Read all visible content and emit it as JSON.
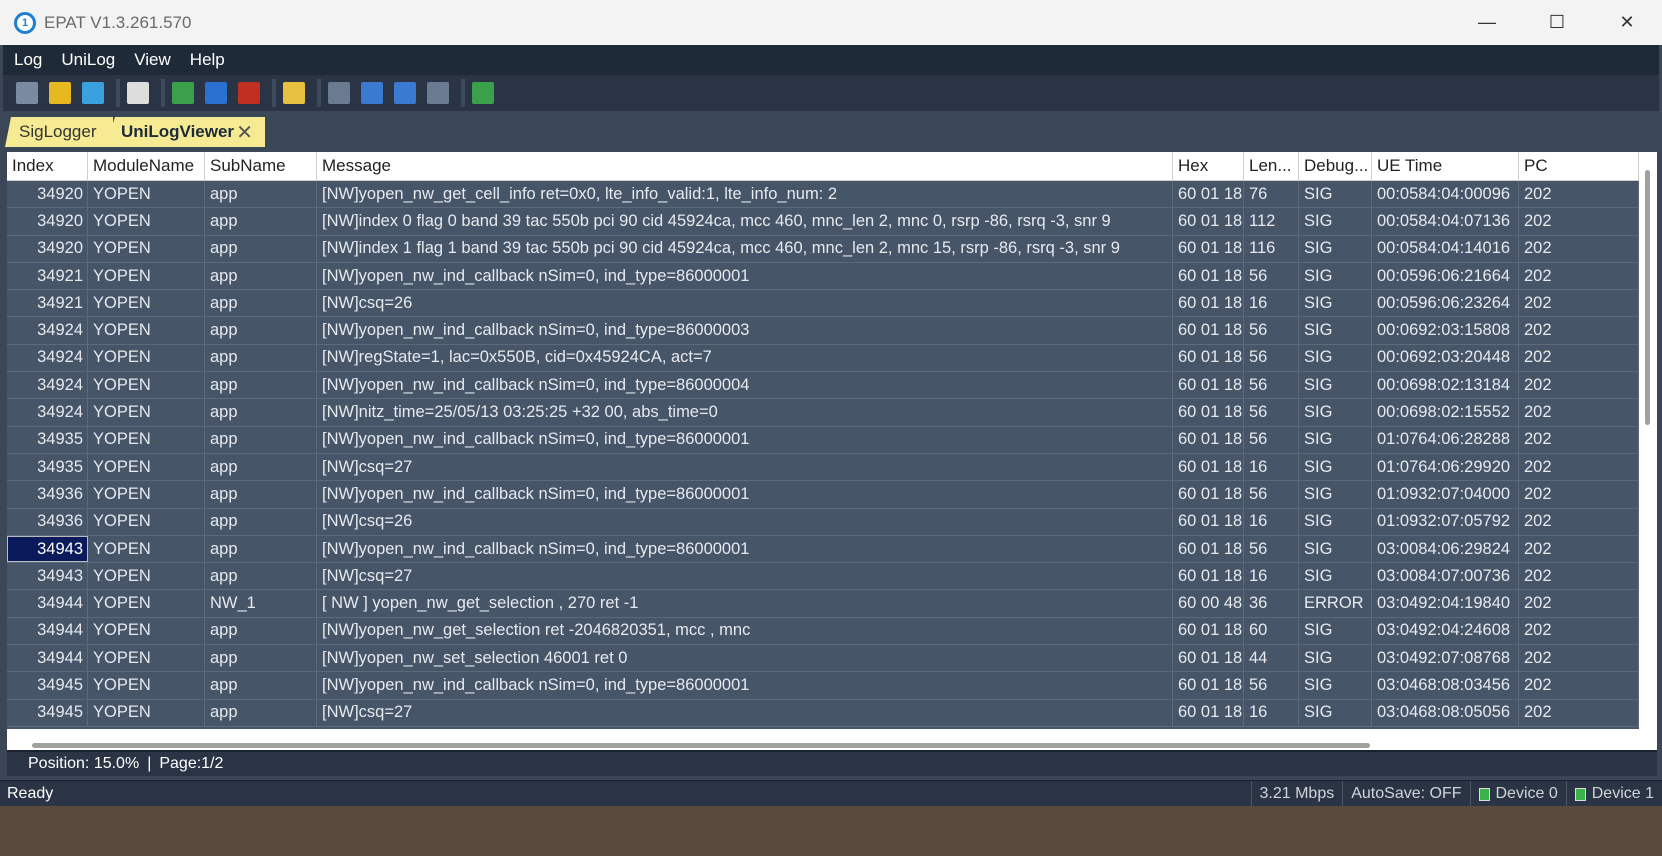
{
  "window": {
    "title": "EPAT V1.3.261.570",
    "icon_glyph": "1",
    "minimize": "—",
    "maximize": "☐",
    "close": "✕"
  },
  "menu": [
    "Log",
    "UniLog",
    "View",
    "Help"
  ],
  "toolbar": [
    {
      "icon": "open-folder-icon",
      "color": "#7a8aa0"
    },
    {
      "icon": "save-icon",
      "color": "#e8b820"
    },
    {
      "icon": "clear-icon",
      "color": "#3aa0e0"
    },
    {
      "icon": "filter-icon",
      "color": "#dddddd"
    },
    {
      "icon": "play-icon",
      "color": "#3aa04a"
    },
    {
      "icon": "pause-icon",
      "color": "#2a70d0"
    },
    {
      "icon": "stop-icon",
      "color": "#c03020"
    },
    {
      "icon": "edit-icon",
      "color": "#e8c040"
    },
    {
      "icon": "first-page-icon",
      "color": "#6a7a90"
    },
    {
      "icon": "prev-page-icon",
      "color": "#3a7ad0"
    },
    {
      "icon": "next-page-icon",
      "color": "#3a7ad0"
    },
    {
      "icon": "last-page-icon",
      "color": "#6a7a90"
    },
    {
      "icon": "connect-icon",
      "color": "#3aa04a"
    }
  ],
  "tabs": [
    {
      "label": "SigLogger"
    },
    {
      "label": "UniLogViewer",
      "close": "✕"
    }
  ],
  "columns": [
    "Index",
    "ModuleName",
    "SubName",
    "Message",
    "Hex",
    "Len...",
    "Debug...",
    "UE Time",
    "PC"
  ],
  "rows": [
    [
      "34920",
      "YOPEN",
      "app",
      "[NW]yopen_nw_get_cell_info ret=0x0, lte_info_valid:1, lte_info_num: 2",
      "60 01 18",
      "76",
      "SIG",
      "00:0584:04:00096",
      "202"
    ],
    [
      "34920",
      "YOPEN",
      "app",
      "[NW]index 0 flag 0 band 39 tac 550b pci 90 cid 45924ca, mcc 460, mnc_len 2, mnc 0, rsrp -86, rsrq -3, snr 9",
      "60 01 18",
      "112",
      "SIG",
      "00:0584:04:07136",
      "202"
    ],
    [
      "34920",
      "YOPEN",
      "app",
      "[NW]index 1 flag 1 band 39 tac 550b pci 90 cid 45924ca, mcc 460, mnc_len 2, mnc 15, rsrp -86, rsrq -3, snr 9",
      "60 01 18",
      "116",
      "SIG",
      "00:0584:04:14016",
      "202"
    ],
    [
      "34921",
      "YOPEN",
      "app",
      "[NW]yopen_nw_ind_callback nSim=0, ind_type=86000001",
      "60 01 18",
      "56",
      "SIG",
      "00:0596:06:21664",
      "202"
    ],
    [
      "34921",
      "YOPEN",
      "app",
      "[NW]csq=26",
      "60 01 18",
      "16",
      "SIG",
      "00:0596:06:23264",
      "202"
    ],
    [
      "34924",
      "YOPEN",
      "app",
      "[NW]yopen_nw_ind_callback nSim=0, ind_type=86000003",
      "60 01 18",
      "56",
      "SIG",
      "00:0692:03:15808",
      "202"
    ],
    [
      "34924",
      "YOPEN",
      "app",
      "[NW]regState=1, lac=0x550B, cid=0x45924CA, act=7",
      "60 01 18",
      "56",
      "SIG",
      "00:0692:03:20448",
      "202"
    ],
    [
      "34924",
      "YOPEN",
      "app",
      "[NW]yopen_nw_ind_callback nSim=0, ind_type=86000004",
      "60 01 18",
      "56",
      "SIG",
      "00:0698:02:13184",
      "202"
    ],
    [
      "34924",
      "YOPEN",
      "app",
      "[NW]nitz_time=25/05/13 03:25:25 +32 00, abs_time=0",
      "60 01 18",
      "56",
      "SIG",
      "00:0698:02:15552",
      "202"
    ],
    [
      "34935",
      "YOPEN",
      "app",
      "[NW]yopen_nw_ind_callback nSim=0, ind_type=86000001",
      "60 01 18",
      "56",
      "SIG",
      "01:0764:06:28288",
      "202"
    ],
    [
      "34935",
      "YOPEN",
      "app",
      "[NW]csq=27",
      "60 01 18",
      "16",
      "SIG",
      "01:0764:06:29920",
      "202"
    ],
    [
      "34936",
      "YOPEN",
      "app",
      "[NW]yopen_nw_ind_callback nSim=0, ind_type=86000001",
      "60 01 18",
      "56",
      "SIG",
      "01:0932:07:04000",
      "202"
    ],
    [
      "34936",
      "YOPEN",
      "app",
      "[NW]csq=26",
      "60 01 18",
      "16",
      "SIG",
      "01:0932:07:05792",
      "202"
    ],
    [
      "34943",
      "YOPEN",
      "app",
      "[NW]yopen_nw_ind_callback nSim=0, ind_type=86000001",
      "60 01 18",
      "56",
      "SIG",
      "03:0084:06:29824",
      "202"
    ],
    [
      "34943",
      "YOPEN",
      "app",
      "[NW]csq=27",
      "60 01 18",
      "16",
      "SIG",
      "03:0084:07:00736",
      "202"
    ],
    [
      "34944",
      "YOPEN",
      "NW_1",
      "[ NW ] yopen_nw_get_selection , 270 ret -1",
      "60 00 48",
      "36",
      "ERROR",
      "03:0492:04:19840",
      "202"
    ],
    [
      "34944",
      "YOPEN",
      "app",
      "[NW]yopen_nw_get_selection ret -2046820351, mcc , mnc",
      "60 01 18",
      "60",
      "SIG",
      "03:0492:04:24608",
      "202"
    ],
    [
      "34944",
      "YOPEN",
      "app",
      "[NW]yopen_nw_set_selection 46001 ret 0",
      "60 01 18",
      "44",
      "SIG",
      "03:0492:07:08768",
      "202"
    ],
    [
      "34945",
      "YOPEN",
      "app",
      "[NW]yopen_nw_ind_callback nSim=0, ind_type=86000001",
      "60 01 18",
      "56",
      "SIG",
      "03:0468:08:03456",
      "202"
    ],
    [
      "34945",
      "YOPEN",
      "app",
      "[NW]csq=27",
      "60 01 18",
      "16",
      "SIG",
      "03:0468:08:05056",
      "202"
    ]
  ],
  "selected_row": 13,
  "position": {
    "text": "Position: 15.0%",
    "sep": "|",
    "page": "Page:1/2"
  },
  "status": {
    "ready": "Ready",
    "rate": "3.21 Mbps",
    "autosave": "AutoSave: OFF",
    "device0": "Device 0",
    "device1": "Device 1"
  }
}
